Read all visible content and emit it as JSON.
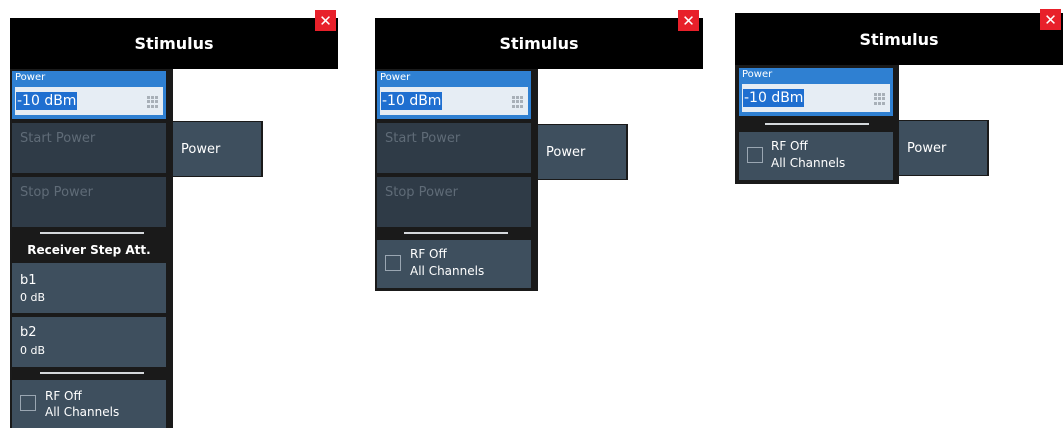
{
  "dialog": {
    "title": "Stimulus",
    "close_label": "✕"
  },
  "power_field": {
    "label": "Power",
    "value": "-10 dBm"
  },
  "buttons": {
    "start_power": "Start Power",
    "stop_power": "Stop Power",
    "side_tab": "Power"
  },
  "receiver": {
    "section_label": "Receiver Step Att.",
    "b1_name": "b1",
    "b1_value": "0 dB",
    "b2_name": "b2",
    "b2_value": "0 dB"
  },
  "rf_off": {
    "line1": "RF Off",
    "line2": "All Channels",
    "checked": false
  },
  "colors": {
    "title_bg": "#000000",
    "close_bg": "#e8202a",
    "power_field_bg": "#2f80d2",
    "button_bg": "#3e4f5e",
    "button_disabled_bg": "#2f3b47"
  }
}
